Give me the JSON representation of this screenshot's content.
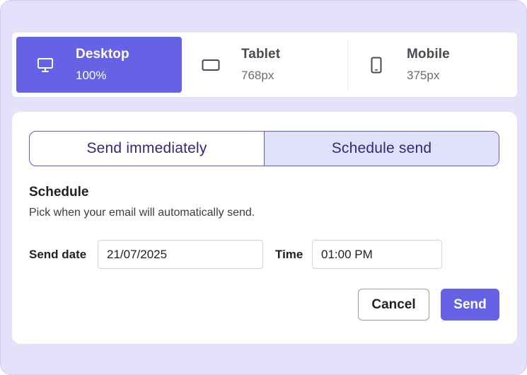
{
  "devices": [
    {
      "name": "Desktop",
      "size": "100%",
      "icon": "desktop-monitor-icon",
      "active": true
    },
    {
      "name": "Tablet",
      "size": "768px",
      "icon": "tablet-icon",
      "active": false
    },
    {
      "name": "Mobile",
      "size": "375px",
      "icon": "mobile-phone-icon",
      "active": false
    }
  ],
  "send_mode": {
    "options": [
      "Send immediately",
      "Schedule send"
    ],
    "selected": "Schedule send"
  },
  "schedule": {
    "title": "Schedule",
    "description": "Pick when your email will automatically send.",
    "date_label": "Send date",
    "date_value": "21/07/2025",
    "time_label": "Time",
    "time_value": "01:00 PM"
  },
  "actions": {
    "cancel_label": "Cancel",
    "send_label": "Send"
  },
  "colors": {
    "accent": "#6562e6",
    "frame_bg": "#e3e2fa",
    "selected_segment_bg": "#e1e0fa"
  }
}
